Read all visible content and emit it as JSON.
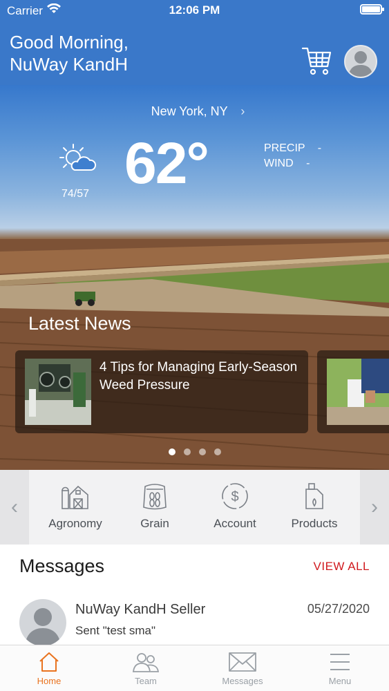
{
  "status_bar": {
    "carrier": "Carrier",
    "time": "12:06 PM"
  },
  "header": {
    "greeting_line1": "Good Morning,",
    "greeting_line2": "NuWay KandH"
  },
  "weather": {
    "location": "New York, NY",
    "location_chevron": "›",
    "temperature": "62°",
    "hi_lo": "74/57",
    "precip_label": "PRECIP",
    "precip_value": "-",
    "wind_label": "WIND",
    "wind_value": "-",
    "condition_icon": "partly-cloudy-icon"
  },
  "news": {
    "title": "Latest News",
    "cards": [
      {
        "headline": "4 Tips for Managing Early-Season Weed Pressure"
      },
      {
        "headline": ""
      }
    ],
    "page_count": 4,
    "active_page": 0
  },
  "quick_actions": {
    "items": [
      {
        "label": "Agronomy",
        "icon": "barn-icon"
      },
      {
        "label": "Grain",
        "icon": "grain-bag-icon"
      },
      {
        "label": "Account",
        "icon": "dollar-icon"
      },
      {
        "label": "Products",
        "icon": "jug-icon"
      }
    ],
    "prev": "‹",
    "next": "›"
  },
  "messages": {
    "title": "Messages",
    "view_all": "VIEW ALL",
    "items": [
      {
        "sender": "NuWay KandH Seller",
        "date": "05/27/2020",
        "preview": "Sent \"test sma\""
      }
    ]
  },
  "tabbar": {
    "tabs": [
      {
        "label": "Home",
        "icon": "home-icon",
        "active": true
      },
      {
        "label": "Team",
        "icon": "team-icon",
        "active": false
      },
      {
        "label": "Messages",
        "icon": "envelope-icon",
        "active": false
      },
      {
        "label": "Menu",
        "icon": "menu-icon",
        "active": false
      }
    ]
  },
  "colors": {
    "header_blue": "#3a78c9",
    "accent_red": "#d0191e",
    "tab_active": "#e9731f"
  }
}
